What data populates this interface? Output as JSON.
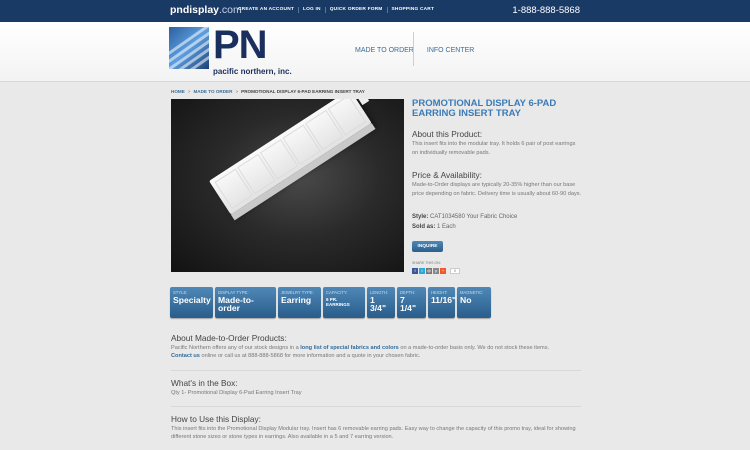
{
  "topbar": {
    "site_name": "pndisplay",
    "site_tld": ".com",
    "nav": [
      "CREATE AN ACCOUNT",
      "LOG IN",
      "QUICK ORDER FORM",
      "SHOPPING CART"
    ],
    "phone": "1-888-888-5868"
  },
  "header": {
    "logo_letters": "PN",
    "logo_name": "pacific northern, inc.",
    "nav": [
      "MADE TO ORDER",
      "INFO CENTER"
    ]
  },
  "breadcrumb": [
    "HOME",
    "MADE TO ORDER",
    "PROMOTIONAL DISPLAY 6-PAD EARRING INSERT TRAY"
  ],
  "product": {
    "title": "PROMOTIONAL DISPLAY 6-PAD EARRING INSERT TRAY",
    "about_heading": "About this Product:",
    "about_text": "This insert fits into the modular tray. It holds 6 pair of post earrings on individually removable pads.",
    "price_heading": "Price & Availability:",
    "price_text": "Made-to-Order displays are typically 20-35% higher than our base price depending on fabric. Delivery time is usually about 60-90 days.",
    "style_label": "Style:",
    "style_value": "CAT1034580 Your Fabric Choice",
    "sold_label": "Sold as:",
    "sold_value": "1 Each",
    "inquire_label": "INQUIRE",
    "share_label": "SHARE THIS ON:",
    "share_count": "0"
  },
  "specs": [
    {
      "label": "STYLE:",
      "value": "Specialty"
    },
    {
      "label": "DISPLAY TYPE:",
      "value": "Made-to-order"
    },
    {
      "label": "JEWELRY TYPE:",
      "value": "Earring"
    },
    {
      "label": "CAPACITY:",
      "value": "6 PR. EARRINGS"
    },
    {
      "label": "LENGTH:",
      "value": "1 3/4\""
    },
    {
      "label": "DEPTH:",
      "value": "7 1/4\""
    },
    {
      "label": "HEIGHT:",
      "value": "11/16\""
    },
    {
      "label": "MAGNETIC:",
      "value": "No"
    }
  ],
  "sections": {
    "made_heading": "About Made-to-Order Products:",
    "made_text_1": "Pacific Northern offers any of our stock designs in a ",
    "made_link": "long list of special fabrics and colors",
    "made_text_2": " on a made-to-order basis only. We do not stock these items.",
    "made_contact": "Contact us",
    "made_text_3": " online or call us at 888-888-5868 for more information and a quote in your chosen fabric.",
    "box_heading": "What's in the Box:",
    "box_text": "Qty 1- Promotional Display 6-Pad Earring Insert Tray",
    "howto_heading": "How to Use this Display:",
    "howto_text": "This insert fits into the Promotional Display Modular tray. Insert has 6 removable earring pads. Easy way to change the capacity of this promo tray, ideal for showing different stone sizes or stone types in earrings. Also available in a 5 and 7 earring version."
  }
}
